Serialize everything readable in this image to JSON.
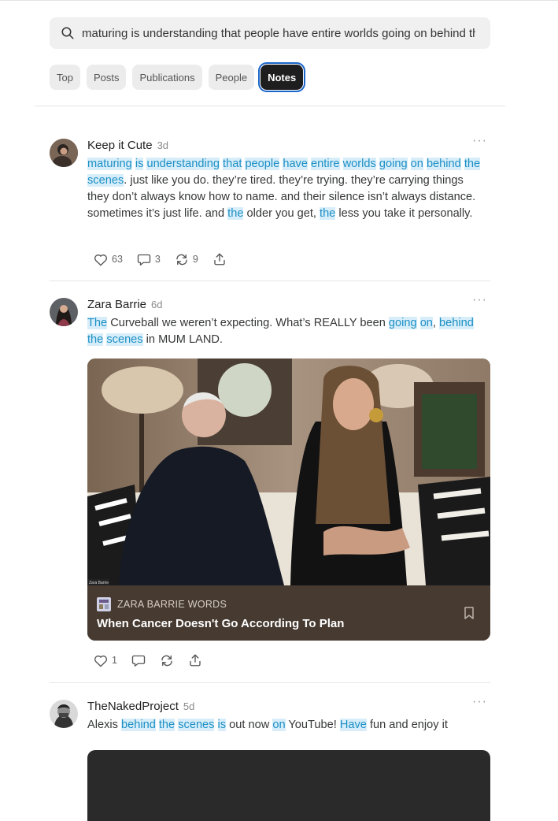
{
  "search": {
    "query": "maturing is understanding that people have entire worlds going on behind the scenes"
  },
  "tabs": [
    {
      "label": "Top"
    },
    {
      "label": "Posts"
    },
    {
      "label": "Publications"
    },
    {
      "label": "People"
    },
    {
      "label": "Notes",
      "active": true
    }
  ],
  "notes": [
    {
      "author": "Keep it Cute",
      "time": "3d",
      "segments": [
        [
          "maturing",
          true
        ],
        [
          " ",
          false
        ],
        [
          "is",
          true
        ],
        [
          " ",
          false
        ],
        [
          "understanding",
          true
        ],
        [
          " ",
          false
        ],
        [
          "that",
          true
        ],
        [
          " ",
          false
        ],
        [
          "people",
          true
        ],
        [
          " ",
          false
        ],
        [
          "have",
          true
        ],
        [
          " ",
          false
        ],
        [
          "entire",
          true
        ],
        [
          " ",
          false
        ],
        [
          "worlds",
          true
        ],
        [
          " ",
          false
        ],
        [
          "going",
          true
        ],
        [
          " ",
          false
        ],
        [
          "on",
          true
        ],
        [
          " ",
          false
        ],
        [
          "behind",
          true
        ],
        [
          " ",
          false
        ],
        [
          "the",
          true
        ],
        [
          " ",
          false
        ],
        [
          "scenes",
          true
        ],
        [
          ". just like you do. they’re tired. they’re trying. they’re carrying things they don’t always know how to name. and their silence isn’t always distance. sometimes it’s just life. and ",
          false
        ],
        [
          "the",
          true
        ],
        [
          " older you get, ",
          false
        ],
        [
          "the",
          true
        ],
        [
          " less you take it personally.",
          false
        ]
      ],
      "likes": "63",
      "comments": "3",
      "restacks": "9"
    },
    {
      "author": "Zara Barrie",
      "time": "6d",
      "segments": [
        [
          "The",
          true
        ],
        [
          " Curveball we weren’t expecting. What’s REALLY been ",
          false
        ],
        [
          "going",
          true
        ],
        [
          " ",
          false
        ],
        [
          "on",
          true
        ],
        [
          ", ",
          false
        ],
        [
          "behind",
          true
        ],
        [
          " ",
          false
        ],
        [
          "the",
          true
        ],
        [
          " ",
          false
        ],
        [
          "scenes",
          true
        ],
        [
          " in MUM LAND.",
          false
        ]
      ],
      "card": {
        "publication": "ZARA BARRIE WORDS",
        "title": "When Cancer Doesn't Go According To Plan",
        "caption": "Zara Barrie"
      },
      "likes": "1"
    },
    {
      "author": "TheNakedProject",
      "time": "5d",
      "segments": [
        [
          "Alexis ",
          false
        ],
        [
          "behind",
          true
        ],
        [
          " ",
          false
        ],
        [
          "the",
          true
        ],
        [
          " ",
          false
        ],
        [
          "scenes",
          true
        ],
        [
          " ",
          false
        ],
        [
          "is",
          true
        ],
        [
          " out now ",
          false
        ],
        [
          "on",
          true
        ],
        [
          " YouTube! ",
          false
        ],
        [
          "Have",
          true
        ],
        [
          " fun and enjoy it",
          false
        ]
      ]
    }
  ],
  "colors": {
    "highlight_bg": "#d7eefa",
    "highlight_text": "#1d8fc4",
    "active_tab": "#1e1e1e",
    "focus_ring": "#1b66c9"
  }
}
